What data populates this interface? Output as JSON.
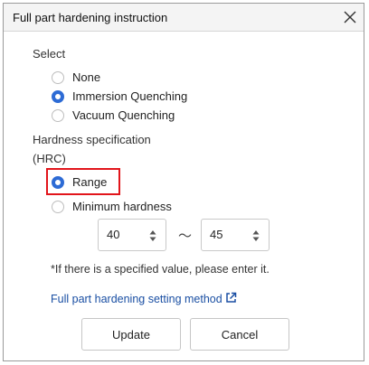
{
  "dialog": {
    "title": "Full part hardening instruction"
  },
  "select": {
    "label": "Select",
    "options": [
      {
        "label": "None",
        "checked": false
      },
      {
        "label": "Immersion Quenching",
        "checked": true
      },
      {
        "label": "Vacuum Quenching",
        "checked": false
      }
    ]
  },
  "hardness": {
    "label": "Hardness specification",
    "unit": "(HRC)",
    "options": [
      {
        "label": "Range",
        "checked": true
      },
      {
        "label": "Minimum hardness",
        "checked": false
      }
    ],
    "min_value": "40",
    "max_value": "45",
    "separator": "～"
  },
  "note": "*If there is a specified value, please enter it.",
  "link": {
    "label": "Full part hardening setting method",
    "icon": "external-link-icon"
  },
  "buttons": {
    "update": "Update",
    "cancel": "Cancel"
  },
  "colors": {
    "accent": "#2d6bd5",
    "highlight": "#e2151b",
    "link": "#1a4fa3"
  }
}
